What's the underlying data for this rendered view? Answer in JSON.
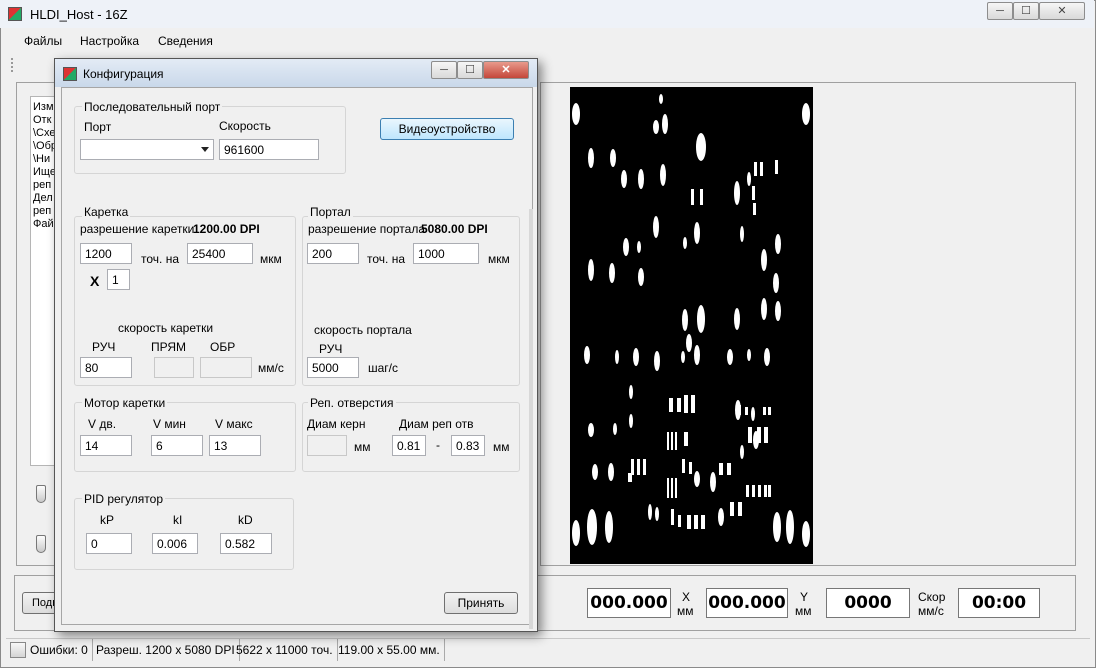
{
  "main_window": {
    "title": "HLDI_Host - 16Z",
    "menu": [
      "Файлы",
      "Настройка",
      "Сведения"
    ],
    "controls": {
      "minimize": "─",
      "maximize": "☐",
      "close": "✕"
    }
  },
  "file_list": {
    "lines": [
      "Изм",
      "Отк",
      "\\Схе",
      "\\Обр",
      "\\Ни",
      "Ище",
      "реп",
      "Дел",
      "реп",
      "Фай"
    ]
  },
  "bottom": {
    "pod_button": "Подключить",
    "x_value": "000.000",
    "x_label": "X",
    "x_unit": "мм",
    "y_value": "000.000",
    "y_label": "Y",
    "y_unit": "мм",
    "speed_value": "0000",
    "speed_label": "Скор",
    "speed_unit": "мм/с",
    "time_value": "00:00"
  },
  "statusbar": {
    "errors": "Ошибки: 0",
    "resolution": "Разреш. 1200 x 5080 DPI",
    "points": "5622 x 11000 точ.",
    "size": "119.00 x 55.00 мм."
  },
  "dialog": {
    "title": "Конфигурация",
    "controls": {
      "minimize": "─",
      "maximize": "☐",
      "close": "✕"
    },
    "serial": {
      "title": "Последовательный порт",
      "port_label": "Порт",
      "port_value": "",
      "speed_label": "Скорость",
      "speed_value": "961600"
    },
    "video_button": "Видеоустройство",
    "carriage": {
      "title": "Каретка",
      "resolution_label": "разрешение каретки",
      "resolution_value": "1200.00 DPI",
      "dots": "1200",
      "dots_label": "точ. на",
      "microns": "25400",
      "microns_label": "мкм",
      "mult_label": "X",
      "mult_value": "1",
      "speed_title": "скорость каретки",
      "manual_label": "РУЧ",
      "forward_label": "ПРЯМ",
      "reverse_label": "ОБР",
      "manual_value": "80",
      "forward_value": "",
      "reverse_value": "",
      "speed_unit": "мм/с"
    },
    "portal": {
      "title": "Портал",
      "resolution_label": "разрешение портала",
      "resolution_value": "5080.00 DPI",
      "dots": "200",
      "dots_label": "точ. на",
      "microns": "1000",
      "microns_label": "мкм",
      "speed_title": "скорость портала",
      "manual_label": "РУЧ",
      "manual_value": "5000",
      "speed_unit": "шаг/с"
    },
    "motor": {
      "title": "Мотор каретки",
      "v_dv_label": "V дв.",
      "v_min_label": "V мин",
      "v_max_label": "V макс",
      "v_dv": "14",
      "v_min": "6",
      "v_max": "13"
    },
    "rep_holes": {
      "title": "Реп. отверстия",
      "kern_label": "Диам керн",
      "kern_value": "",
      "kern_unit": "мм",
      "rep_label": "Диам реп отв",
      "rep_min": "0.81",
      "dash": "-",
      "rep_max": "0.83",
      "rep_unit": "мм"
    },
    "pid": {
      "title": "PID регулятор",
      "kp_label": "kP",
      "ki_label": "kI",
      "kd_label": "kD",
      "kp": "0",
      "ki": "0.006",
      "kd": "0.582"
    },
    "accept_button": "Принять"
  }
}
